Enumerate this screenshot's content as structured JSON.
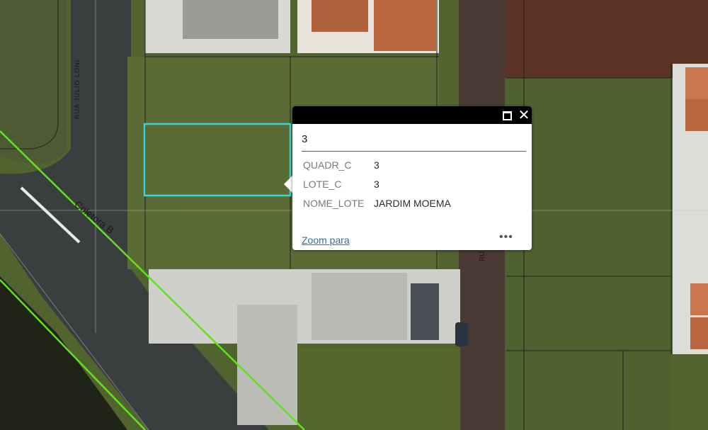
{
  "map": {
    "street_labels": {
      "rua_julio_loni": "RUA JULIO LONI",
      "coletora_b": "Coletora B",
      "ru": "RU"
    },
    "colors": {
      "selection_outline": "#39d6d6",
      "line_green": "#5fe31f",
      "parcel_lines": "#222222"
    }
  },
  "popup": {
    "title": "3",
    "attributes": [
      {
        "key": "QUADR_C",
        "value": "3"
      },
      {
        "key": "LOTE_C",
        "value": "3"
      },
      {
        "key": "NOME_LOTE",
        "value": "JARDIM MOEMA"
      }
    ],
    "zoom_label": "Zoom para",
    "more_label": "•••",
    "maximize_icon": "maximize-icon",
    "close_icon": "close-icon",
    "close_glyph": "✕"
  }
}
